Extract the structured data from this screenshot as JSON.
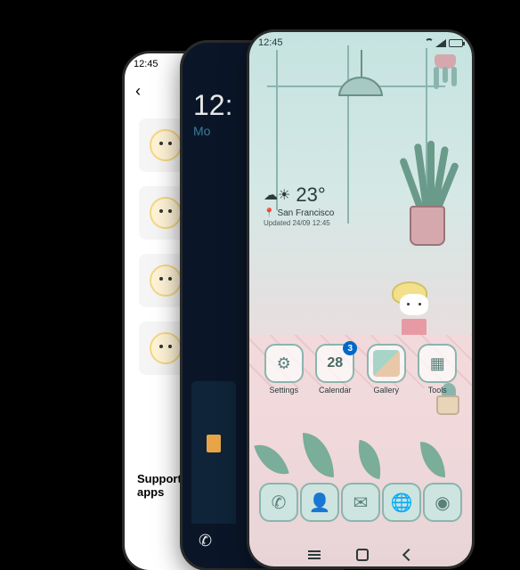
{
  "status": {
    "time": "12:45"
  },
  "phone1": {
    "support_label": "Support\napps"
  },
  "phone2": {
    "time_prefix": "12:",
    "date_prefix": "Mo"
  },
  "phone3": {
    "weather": {
      "temp": "23°",
      "location": "San Francisco",
      "updated": "Updated 24/09 12:45"
    },
    "apps": {
      "settings": {
        "label": "Settings"
      },
      "calendar": {
        "label": "Calendar",
        "date": "28",
        "badge": "3"
      },
      "gallery": {
        "label": "Gallery"
      },
      "tools": {
        "label": "Tools"
      }
    }
  }
}
